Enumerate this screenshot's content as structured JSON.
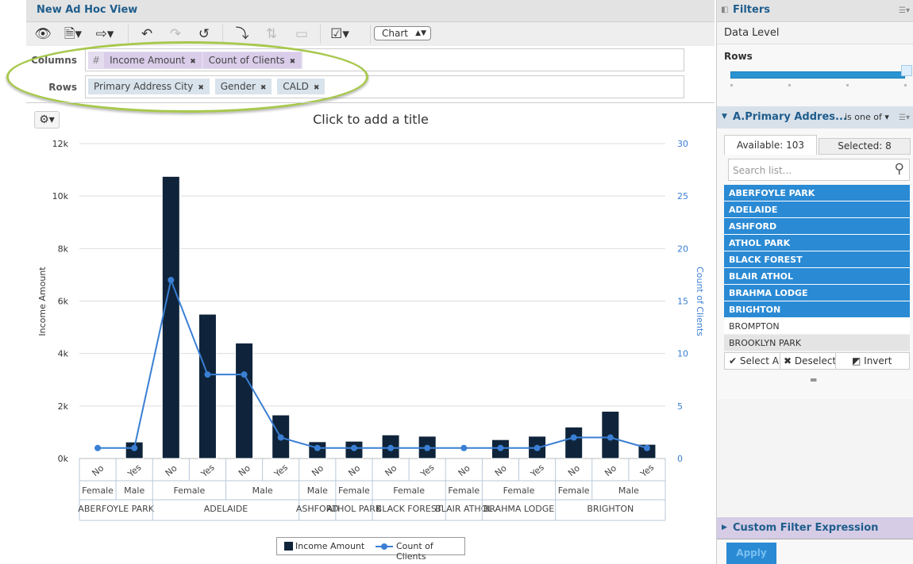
{
  "header": {
    "title": "New Ad Hoc View"
  },
  "toolbar": {
    "view_type": "Chart"
  },
  "columns": {
    "label": "Columns",
    "hash": "#",
    "items": [
      "Income Amount",
      "Count of Clients"
    ]
  },
  "rows": {
    "label": "Rows",
    "items": [
      "Primary Address City",
      "Gender",
      "CALD"
    ]
  },
  "chart_title_placeholder": "Click to add a title",
  "chart_data": {
    "type": "bar+line",
    "title": "",
    "ylabel": "Income Amount",
    "y2label": "Count of Clients",
    "ylim": [
      0,
      12000
    ],
    "y2lim": [
      0,
      30
    ],
    "yticks": [
      "0k",
      "2k",
      "4k",
      "6k",
      "8k",
      "10k",
      "12k"
    ],
    "y2ticks": [
      "0",
      "5",
      "10",
      "15",
      "20",
      "25",
      "30"
    ],
    "grid": true,
    "legend_placement": "bottom",
    "colors": {
      "bar": "#0f243a",
      "line": "#3a7fd4"
    },
    "categories": [
      {
        "city": "ABERFOYLE PARK",
        "gender": "Female",
        "cald": "No"
      },
      {
        "city": "ABERFOYLE PARK",
        "gender": "Male",
        "cald": "Yes"
      },
      {
        "city": "ADELAIDE",
        "gender": "Female",
        "cald": "No"
      },
      {
        "city": "ADELAIDE",
        "gender": "Female",
        "cald": "Yes"
      },
      {
        "city": "ADELAIDE",
        "gender": "Male",
        "cald": "No"
      },
      {
        "city": "ADELAIDE",
        "gender": "Male",
        "cald": "Yes"
      },
      {
        "city": "ASHFORD",
        "gender": "Male",
        "cald": "No"
      },
      {
        "city": "ATHOL PARK",
        "gender": "Female",
        "cald": "No"
      },
      {
        "city": "BLACK FOREST",
        "gender": "Female",
        "cald": "No"
      },
      {
        "city": "BLACK FOREST",
        "gender": "Female",
        "cald": "Yes"
      },
      {
        "city": "BLAIR ATHOL",
        "gender": "Female",
        "cald": "No"
      },
      {
        "city": "BRAHMA LODGE",
        "gender": "Female",
        "cald": "No"
      },
      {
        "city": "BRAHMA LODGE",
        "gender": "Female",
        "cald": "Yes"
      },
      {
        "city": "BRIGHTON",
        "gender": "Female",
        "cald": "No"
      },
      {
        "city": "BRIGHTON",
        "gender": "Male",
        "cald": "No"
      },
      {
        "city": "BRIGHTON",
        "gender": "Male",
        "cald": "Yes"
      }
    ],
    "series": [
      {
        "name": "Income Amount",
        "type": "bar",
        "axis": "left",
        "values": [
          0,
          630,
          10750,
          5500,
          4400,
          1660,
          640,
          660,
          900,
          850,
          0,
          720,
          850,
          1200,
          1800,
          540
        ]
      },
      {
        "name": "Count of Clients",
        "type": "line",
        "axis": "right",
        "values": [
          1,
          1,
          17,
          8,
          8,
          2,
          1,
          1,
          1,
          1,
          1,
          1,
          1,
          2,
          2,
          1
        ]
      }
    ]
  },
  "filters": {
    "title": "Filters",
    "data_level": "Data Level",
    "rows_label": "Rows",
    "slider_level": 1.0,
    "filter": {
      "name": "A.Primary Addres...",
      "operator": "is one of",
      "available_tab": "Available: 103",
      "selected_tab": "Selected: 8",
      "search_placeholder": "Search list...",
      "items": [
        {
          "label": "ABERFOYLE PARK",
          "selected": true
        },
        {
          "label": "ADELAIDE",
          "selected": true
        },
        {
          "label": "ASHFORD",
          "selected": true
        },
        {
          "label": "ATHOL PARK",
          "selected": true
        },
        {
          "label": "BLACK FOREST",
          "selected": true
        },
        {
          "label": "BLAIR ATHOL",
          "selected": true
        },
        {
          "label": "BRAHMA LODGE",
          "selected": true
        },
        {
          "label": "BRIGHTON",
          "selected": true
        },
        {
          "label": "BROMPTON",
          "selected": false
        },
        {
          "label": "BROOKLYN PARK",
          "selected": false
        }
      ],
      "select_all": "Select All",
      "deselect": "Deselect",
      "invert": "Invert"
    },
    "custom_expression": "Custom Filter Expression",
    "apply": "Apply"
  }
}
